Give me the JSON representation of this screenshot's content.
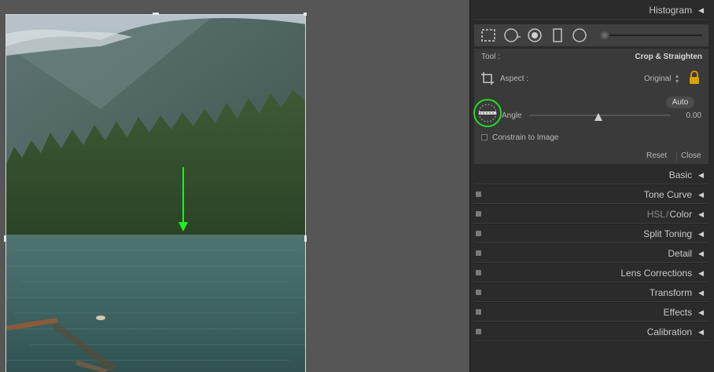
{
  "panel": {
    "histogram_label": "Histogram",
    "tool_label": "Tool :",
    "tool_name": "Crop & Straighten",
    "aspect_label": "Aspect :",
    "aspect_value": "Original",
    "auto_label": "Auto",
    "angle_label": "Angle",
    "angle_value": "0.00",
    "constrain_label": "Constrain to Image",
    "reset_label": "Reset",
    "close_label": "Close",
    "sections": {
      "basic": "Basic",
      "tone_curve": "Tone Curve",
      "hsl": "HSL",
      "hsl_sep": "/",
      "color": "Color",
      "split_toning": "Split Toning",
      "detail": "Detail",
      "lens_corrections": "Lens Corrections",
      "transform": "Transform",
      "effects": "Effects",
      "calibration": "Calibration"
    }
  },
  "icons": {
    "collapse": "triangle-left-icon",
    "tools": [
      "crop-overlay-icon",
      "spot-removal-icon",
      "red-eye-icon",
      "graduated-filter-icon",
      "radial-filter-icon",
      "adjustment-brush-icon"
    ],
    "lock": "lock-icon",
    "straighten": "straighten-tool-icon"
  },
  "colors": {
    "highlight_circle": "#22dd22",
    "guide_arrow": "#22ee22",
    "lock": "#d9a400"
  }
}
